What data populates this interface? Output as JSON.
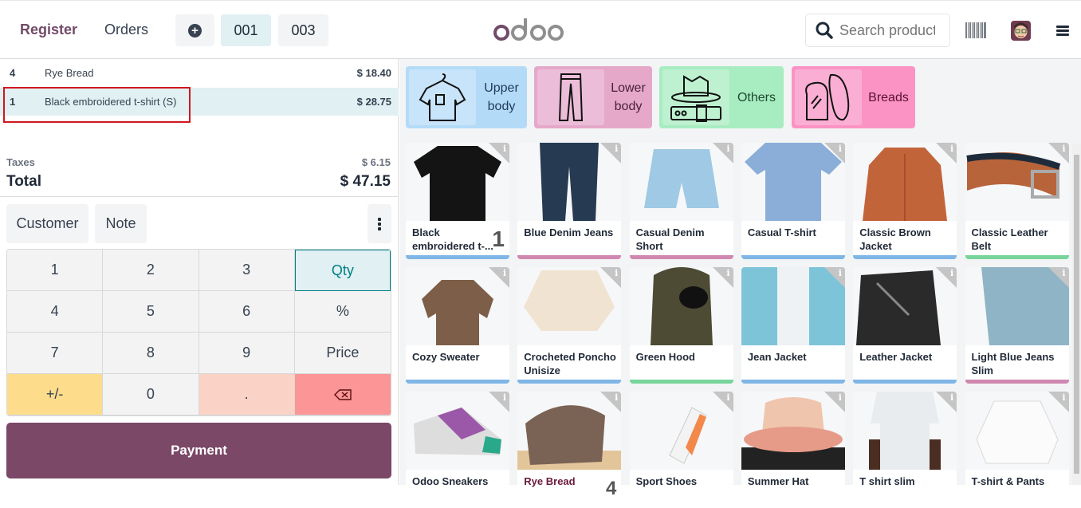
{
  "topbar": {
    "register_label": "Register",
    "orders_label": "Orders",
    "add_order_icon": "plus-circle-icon",
    "order_tabs": [
      "001",
      "003"
    ],
    "active_order": "001",
    "logo_text": "odoo",
    "search_placeholder": "Search products...",
    "search_value": "",
    "barcode_icon": "barcode-icon",
    "avatar_icon": "user-avatar",
    "menu_icon": "hamburger-icon"
  },
  "order": {
    "lines": [
      {
        "qty": "4",
        "name": "Rye Bread",
        "price": "$ 18.40",
        "selected": false
      },
      {
        "qty": "1",
        "name": "Black embroidered t-shirt (S)",
        "price": "$ 28.75",
        "selected": true
      }
    ],
    "taxes_label": "Taxes",
    "taxes_value": "$ 6.15",
    "total_label": "Total",
    "total_value": "$ 47.15"
  },
  "controls": {
    "customer_label": "Customer",
    "note_label": "Note",
    "more_icon": "kebab-icon"
  },
  "numpad": {
    "keys": [
      "1",
      "2",
      "3",
      "Qty",
      "4",
      "5",
      "6",
      "%",
      "7",
      "8",
      "9",
      "Price",
      "+/-",
      "0",
      ".",
      "⌫"
    ],
    "active_mode": "Qty"
  },
  "payment_label": "Payment",
  "categories": [
    {
      "label": "Upper body",
      "icon": "tshirt-hanger-icon",
      "color": "#b3dbf8"
    },
    {
      "label": "Lower body",
      "icon": "pants-icon",
      "color": "#e5a8c9"
    },
    {
      "label": "Others",
      "icon": "hat-belt-icon",
      "color": "#a8ecc2"
    },
    {
      "label": "Breads",
      "icon": "bread-icon",
      "color": "#fb94c5"
    }
  ],
  "products": [
    {
      "name": "Black embroidered t-...",
      "category_color": "#7fb6e6",
      "qty_badge": "1",
      "image": "black-tshirt"
    },
    {
      "name": "Blue Denim Jeans",
      "category_color": "#d088b0",
      "image": "blue-jeans"
    },
    {
      "name": "Casual Denim Short",
      "category_color": "#d088b0",
      "image": "denim-short"
    },
    {
      "name": "Casual T-shirt",
      "category_color": "#7fb6e6",
      "image": "blue-tshirt"
    },
    {
      "name": "Classic Brown Jacket",
      "category_color": "#7fb6e6",
      "image": "brown-jacket"
    },
    {
      "name": "Classic Leather Belt",
      "category_color": "#77d49a",
      "image": "leather-belt"
    },
    {
      "name": "Cozy Sweater",
      "category_color": "#7fb6e6",
      "image": "brown-sweater"
    },
    {
      "name": "Crocheted Poncho Unisize",
      "category_color": "#7fb6e6",
      "image": "poncho"
    },
    {
      "name": "Green Hood",
      "category_color": "#77d49a",
      "image": "green-hood"
    },
    {
      "name": "Jean Jacket",
      "category_color": "#7fb6e6",
      "image": "jean-jacket"
    },
    {
      "name": "Leather Jacket",
      "category_color": "#7fb6e6",
      "image": "leather-jacket"
    },
    {
      "name": "Light Blue Jeans Slim",
      "category_color": "#d088b0",
      "image": "light-jeans"
    },
    {
      "name": "Odoo Sneakers",
      "category_color": "",
      "image": "sneakers"
    },
    {
      "name": "Rye Bread",
      "category_color": "",
      "qty_badge": "4",
      "image": "rye-bread"
    },
    {
      "name": "Sport Shoes",
      "category_color": "",
      "image": "sport-shoes"
    },
    {
      "name": "Summer Hat",
      "category_color": "",
      "image": "summer-hat"
    },
    {
      "name": "T shirt slim",
      "category_color": "",
      "image": "white-tshirt"
    },
    {
      "name": "T-shirt & Pants",
      "category_color": "",
      "image": "white-sweater"
    }
  ]
}
